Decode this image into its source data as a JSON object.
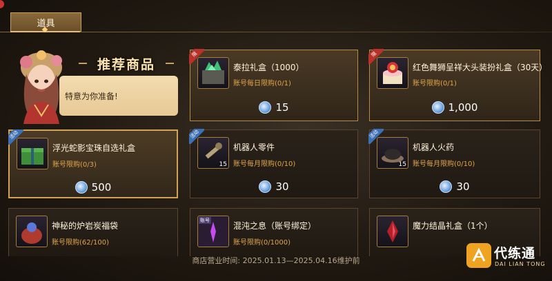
{
  "tab": {
    "label": "道具"
  },
  "recommend": {
    "title": "推荐商品",
    "message": "特意为你准备!"
  },
  "badges": {
    "limited": "限",
    "event": "活动",
    "bound": "账号"
  },
  "products": [
    {
      "name": "泰拉礼盒（1000）",
      "limit": "账号每日限购(0/1)",
      "price": "15",
      "badge": "限",
      "icon": "green-crystal-box-icon"
    },
    {
      "name": "红色舞狮呈祥大头装扮礼盒（30天）",
      "limit": "账号限购(0/1)",
      "price": "1,000",
      "badge": "限",
      "icon": "lion-cake-box-icon"
    },
    {
      "name": "浮光蛇影宝珠自选礼盒",
      "limit": "账号限购(0/3)",
      "price": "500",
      "badge": "活动",
      "icon": "green-gift-box-icon"
    },
    {
      "name": "机器人零件",
      "limit": "账号每月限购(0/10)",
      "price": "30",
      "badge": "活动",
      "quantity": "15",
      "icon": "wrench-parts-icon"
    },
    {
      "name": "机器人火药",
      "limit": "账号每月限购(0/10)",
      "price": "30",
      "badge": "活动",
      "quantity": "15",
      "icon": "gunpowder-pile-icon"
    },
    {
      "name": "神秘的炉岩炭福袋",
      "limit": "账号限购(62/100)",
      "icon": "lucky-bag-icon"
    },
    {
      "name": "混沌之息（账号绑定）",
      "limit": "账号限购(0/1000)",
      "badge": "账号",
      "icon": "chaos-breath-icon"
    },
    {
      "name": "魔力结晶礼盒（1个）",
      "icon": "red-crystal-icon"
    }
  ],
  "footer": {
    "hours": "商店营业时间: 2025.01.13—2025.04.16维护前"
  },
  "watermark": {
    "cn": "代练通",
    "en": "DAI LIAN TONG"
  },
  "colors": {
    "accent_gold": "#d1a35a",
    "limit_orange": "#e0a54c",
    "coin_blue": "#6aa1dd"
  }
}
